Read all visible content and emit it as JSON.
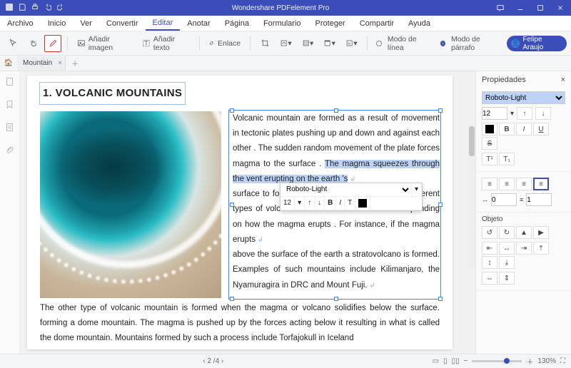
{
  "app": {
    "title": "Wondershare PDFelement Pro"
  },
  "menu": {
    "items": [
      "Archivo",
      "Inicio",
      "Ver",
      "Convertir",
      "Editar",
      "Anotar",
      "Página",
      "Formulario",
      "Proteger",
      "Compartir",
      "Ayuda"
    ],
    "active_index": 4
  },
  "toolbar": {
    "add_image": "Añadir imagen",
    "add_text": "Añadir texto",
    "link": "Enlace",
    "mode_line": "Modo de línea",
    "mode_paragraph": "Modo de párrafo"
  },
  "user": {
    "name": "Felipe Araujo"
  },
  "tabs": {
    "doc_name": "Mountain"
  },
  "document": {
    "heading_num": "1.",
    "heading": "VOLCANIC MOUNTAINS",
    "col_text_before": "Volcanic mountain are formed as a result of movement in tectonic plates pushing up and down and against each other . The sudden random movement  of the plate forces magma to the surface . ",
    "col_text_selected": "The magma squeezes through the vent erupting on the earth 's",
    "col_text_after_1": "surface to form volcanic mountains . There are different types of volcanic mountains that are formed depending on how the magma erupts . For instance, if the magma erupts",
    "col_text_after_2": "above the surface of the earth a stratovolcano is formed. Examples of such mountains include Kilimanjaro, the Nyamuragira in DRC and Mount Fuji.",
    "below_text": "The other type of volcanic mountain is formed when the magma or volcano solidifies below the surface. forming a dome mountain. The magma is pushed up by the forces acting below it resulting in what is called the dome mountain. Mountains formed by such a process include Torfajokull in Iceland"
  },
  "popover": {
    "font": "Roboto-Light",
    "size": "12"
  },
  "properties": {
    "title": "Propiedades",
    "font": "Roboto-Light",
    "size": "12",
    "char_spacing": "0",
    "line_spacing": "1",
    "object_title": "Objeto"
  },
  "status": {
    "page_current": "2",
    "page_total": "/4",
    "zoom": "130%"
  }
}
